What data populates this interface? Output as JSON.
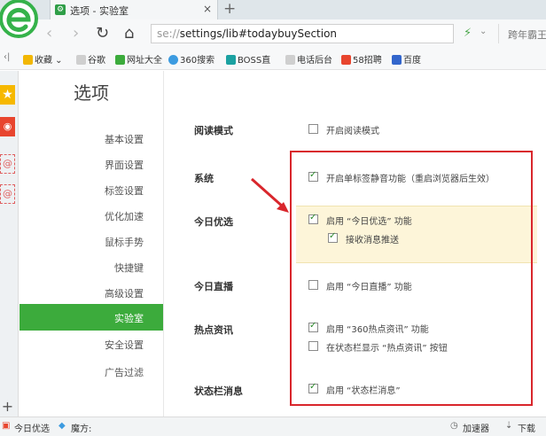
{
  "tab": {
    "title": "选项 - 实验室",
    "close": "×",
    "new_tab": "+"
  },
  "address": {
    "prefix": "se://",
    "path": "settings/lib#todaybuySection"
  },
  "search": {
    "text": "跨年霸王"
  },
  "bookmarks": [
    {
      "label": "收藏 ⌄",
      "color": "#f2b705"
    },
    {
      "label": "谷歌",
      "color": "#cccccc"
    },
    {
      "label": "网址大全",
      "color": "#3cab3c"
    },
    {
      "label": "360搜索",
      "color": "#3c9be0"
    },
    {
      "label": "BOSS直",
      "color": "#1ba1a1"
    },
    {
      "label": "电话后台",
      "color": "#cccccc"
    },
    {
      "label": "58招聘",
      "color": "#e8452e"
    },
    {
      "label": "百度",
      "color": "#3366cc"
    }
  ],
  "sidebar": {
    "title": "选项",
    "items": [
      "基本设置",
      "界面设置",
      "标签设置",
      "优化加速",
      "鼠标手势",
      "快捷键",
      "高级设置",
      "实验室",
      "安全设置",
      "广告过滤"
    ],
    "active": "实验室"
  },
  "sections": {
    "reading": {
      "title": "阅读模式",
      "opt1": "开启阅读模式"
    },
    "system": {
      "title": "系统",
      "opt1": "开启单标签静音功能（重启浏览器后生效）"
    },
    "today": {
      "title": "今日优选",
      "opt1": "启用 “今日优选” 功能",
      "opt2": "接收消息推送"
    },
    "live": {
      "title": "今日直播",
      "opt1": "启用 “今日直播” 功能"
    },
    "hot": {
      "title": "热点资讯",
      "opt1": "启用 “360热点资讯” 功能",
      "opt2": "在状态栏显示 “热点资讯” 按钮"
    },
    "status": {
      "title": "状态栏消息",
      "opt1": "启用 “状态栏消息”"
    }
  },
  "statusbar": {
    "today": "今日优选",
    "magic": "魔方:",
    "accel": "加速器",
    "download": "下载"
  },
  "colors": {
    "accent_green": "#3cab3c",
    "red_box": "#d9262c",
    "highlight": "#fdf5d9"
  }
}
